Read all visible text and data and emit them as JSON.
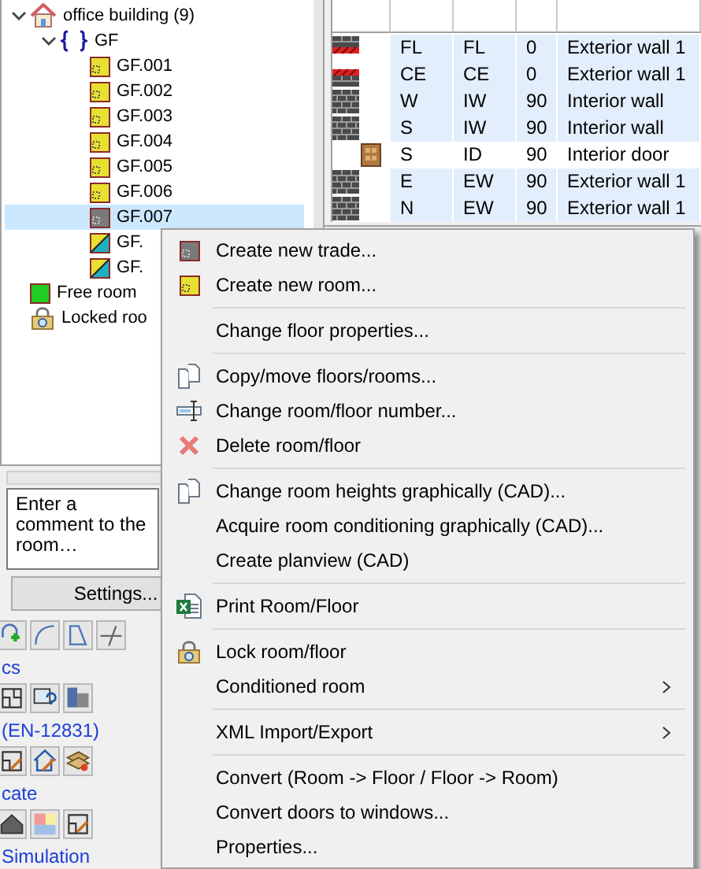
{
  "tree": [
    {
      "label": "office building (9)",
      "kind": "building",
      "expanded": true,
      "selected": false,
      "children": [
        {
          "label": "GF",
          "kind": "floor",
          "expanded": true,
          "selected": false,
          "children": [
            {
              "label": "GF.001",
              "kind": "room",
              "selected": false
            },
            {
              "label": "GF.002",
              "kind": "room",
              "selected": false
            },
            {
              "label": "GF.003",
              "kind": "room",
              "selected": false
            },
            {
              "label": "GF.004",
              "kind": "room",
              "selected": false
            },
            {
              "label": "GF.005",
              "kind": "room",
              "selected": false
            },
            {
              "label": "GF.006",
              "kind": "room",
              "selected": false
            },
            {
              "label": "GF.007",
              "kind": "trade",
              "selected": true
            },
            {
              "label": "GF.",
              "kind": "mixed",
              "selected": false
            },
            {
              "label": "GF.",
              "kind": "mixed",
              "selected": false
            }
          ]
        }
      ]
    },
    {
      "label": "Free room",
      "kind": "free",
      "selected": false
    },
    {
      "label": "Locked roo",
      "kind": "locked",
      "selected": false
    }
  ],
  "comment": {
    "placeholder": "Enter a comment to the room…"
  },
  "settings_button": "Settings...",
  "tool_sections": [
    "cs",
    "(EN-12831)",
    "cate",
    "Simulation"
  ],
  "table": {
    "rows": [
      {
        "kind": "floor-slab",
        "orientation": "FL",
        "type": "FL",
        "angle": "0",
        "description": "Exterior wall 1",
        "highlighted": true
      },
      {
        "kind": "ceiling-slab",
        "orientation": "CE",
        "type": "CE",
        "angle": "0",
        "description": "Exterior wall 1",
        "highlighted": true
      },
      {
        "kind": "wall",
        "orientation": "W",
        "type": "IW",
        "angle": "90",
        "description": "Interior wall",
        "highlighted": true
      },
      {
        "kind": "wall",
        "orientation": "S",
        "type": "IW",
        "angle": "90",
        "description": "Interior wall",
        "highlighted": true
      },
      {
        "kind": "door",
        "orientation": "S",
        "type": "ID",
        "angle": "90",
        "description": "Interior door",
        "highlighted": false
      },
      {
        "kind": "wall",
        "orientation": "E",
        "type": "EW",
        "angle": "90",
        "description": "Exterior wall 1",
        "highlighted": true
      },
      {
        "kind": "wall",
        "orientation": "N",
        "type": "EW",
        "angle": "90",
        "description": "Exterior wall 1",
        "highlighted": true
      }
    ]
  },
  "context_menu": [
    {
      "kind": "item",
      "label": "Create new trade...",
      "submenu": false
    },
    {
      "kind": "item",
      "label": "Create new room...",
      "submenu": false
    },
    {
      "kind": "separator"
    },
    {
      "kind": "item",
      "label": "Change floor properties...",
      "submenu": false
    },
    {
      "kind": "separator"
    },
    {
      "kind": "item",
      "label": "Copy/move floors/rooms...",
      "submenu": false
    },
    {
      "kind": "item",
      "label": "Change room/floor number...",
      "submenu": false
    },
    {
      "kind": "item",
      "label": "Delete room/floor",
      "submenu": false
    },
    {
      "kind": "separator"
    },
    {
      "kind": "item",
      "label": "Change room heights graphically (CAD)...",
      "submenu": false
    },
    {
      "kind": "item",
      "label": "Acquire room conditioning graphically (CAD)...",
      "submenu": false
    },
    {
      "kind": "item",
      "label": "Create planview (CAD)",
      "submenu": false
    },
    {
      "kind": "separator"
    },
    {
      "kind": "item",
      "label": "Print Room/Floor",
      "submenu": false
    },
    {
      "kind": "separator"
    },
    {
      "kind": "item",
      "label": "Lock room/floor",
      "submenu": false
    },
    {
      "kind": "item",
      "label": "Conditioned room",
      "submenu": true
    },
    {
      "kind": "separator"
    },
    {
      "kind": "item",
      "label": "XML Import/Export",
      "submenu": true
    },
    {
      "kind": "separator"
    },
    {
      "kind": "item",
      "label": "Convert (Room -> Floor / Floor -> Room)",
      "submenu": false
    },
    {
      "kind": "item",
      "label": "Convert doors to windows...",
      "submenu": false
    },
    {
      "kind": "item",
      "label": "Properties...",
      "submenu": false
    }
  ]
}
